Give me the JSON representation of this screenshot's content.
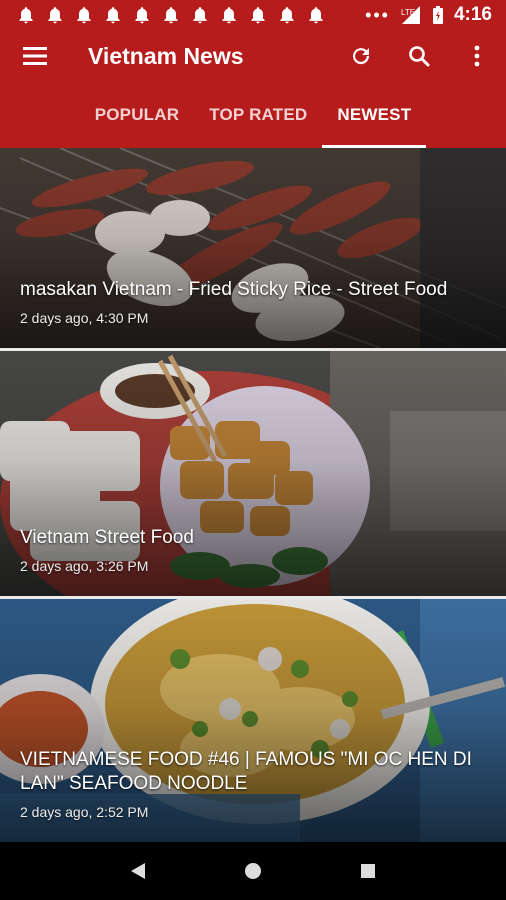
{
  "status_bar": {
    "notification_count": 11,
    "time": "4:16",
    "network": "LTE"
  },
  "app_bar": {
    "title": "Vietnam News",
    "icons": [
      "menu-icon",
      "refresh-icon",
      "search-icon",
      "more-vert-icon"
    ]
  },
  "tabs": [
    {
      "label": "POPULAR",
      "active": false
    },
    {
      "label": "TOP RATED",
      "active": false
    },
    {
      "label": "NEWEST",
      "active": true
    }
  ],
  "feed": [
    {
      "title": "masakan Vietnam - Fried Sticky Rice - Street Food",
      "meta": "2 days ago, 4:30 PM",
      "image": "grilled-sausages-thumbnail"
    },
    {
      "title": "Vietnam Street Food",
      "meta": "2 days ago, 3:26 PM",
      "image": "fried-tofu-plate-thumbnail"
    },
    {
      "title": "VIETNAMESE FOOD #46 | FAMOUS \"MI OC HEN DI LAN\" SEAFOOD NOODLE",
      "meta": "2 days ago, 2:52 PM",
      "image": "seafood-noodle-bowl-thumbnail"
    }
  ],
  "colors": {
    "primary": "#b71c1c",
    "tab_indicator": "#ffffff",
    "nav_background": "#000000"
  }
}
